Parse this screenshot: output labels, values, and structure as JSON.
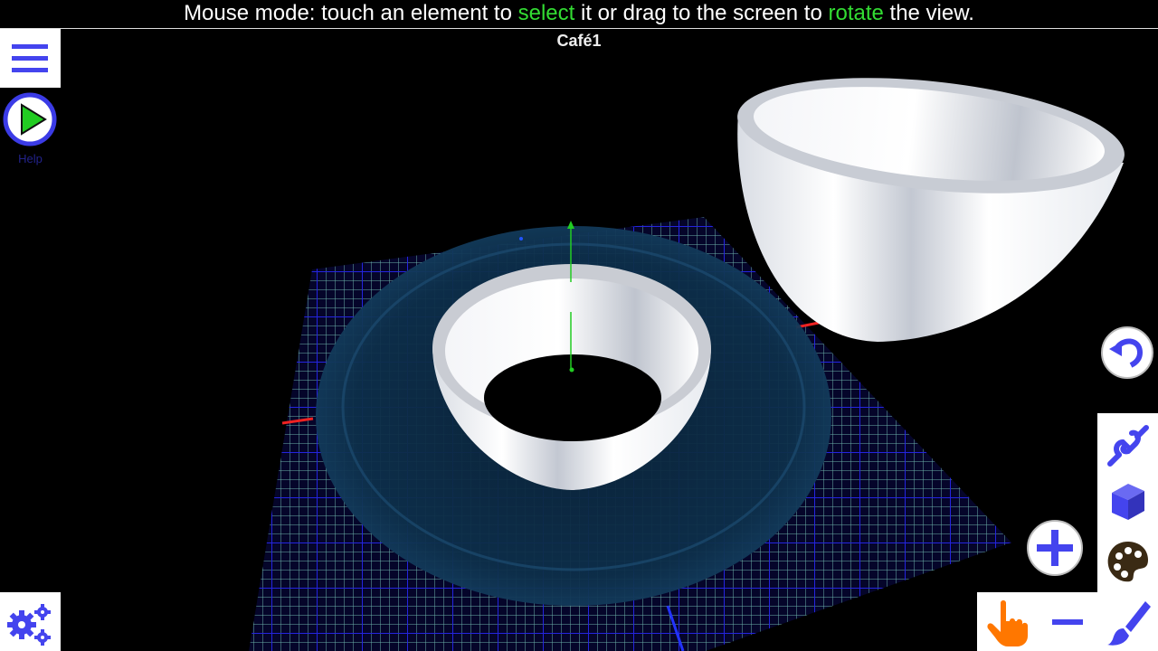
{
  "instruction": {
    "part1": "Mouse mode: touch an element to ",
    "action1": "select",
    "part2": " it or drag to the screen to ",
    "action2": "rotate",
    "part3": " the view."
  },
  "model": {
    "title": "Café1"
  },
  "toolbar_left": {
    "play_label": "Help"
  },
  "icons": {
    "menu": "hamburger-icon",
    "play": "play-icon",
    "settings": "gears-icon",
    "undo": "undo-icon",
    "link": "link-icon",
    "cube": "cube-icon",
    "palette": "palette-icon",
    "add": "plus-icon",
    "hand": "hand-pointer-icon",
    "minus": "minus-icon",
    "brush": "brush-icon"
  },
  "colors": {
    "accent": "#4444ee",
    "highlight": "#33dd33",
    "hand": "#ff7700",
    "background": "#000000"
  }
}
